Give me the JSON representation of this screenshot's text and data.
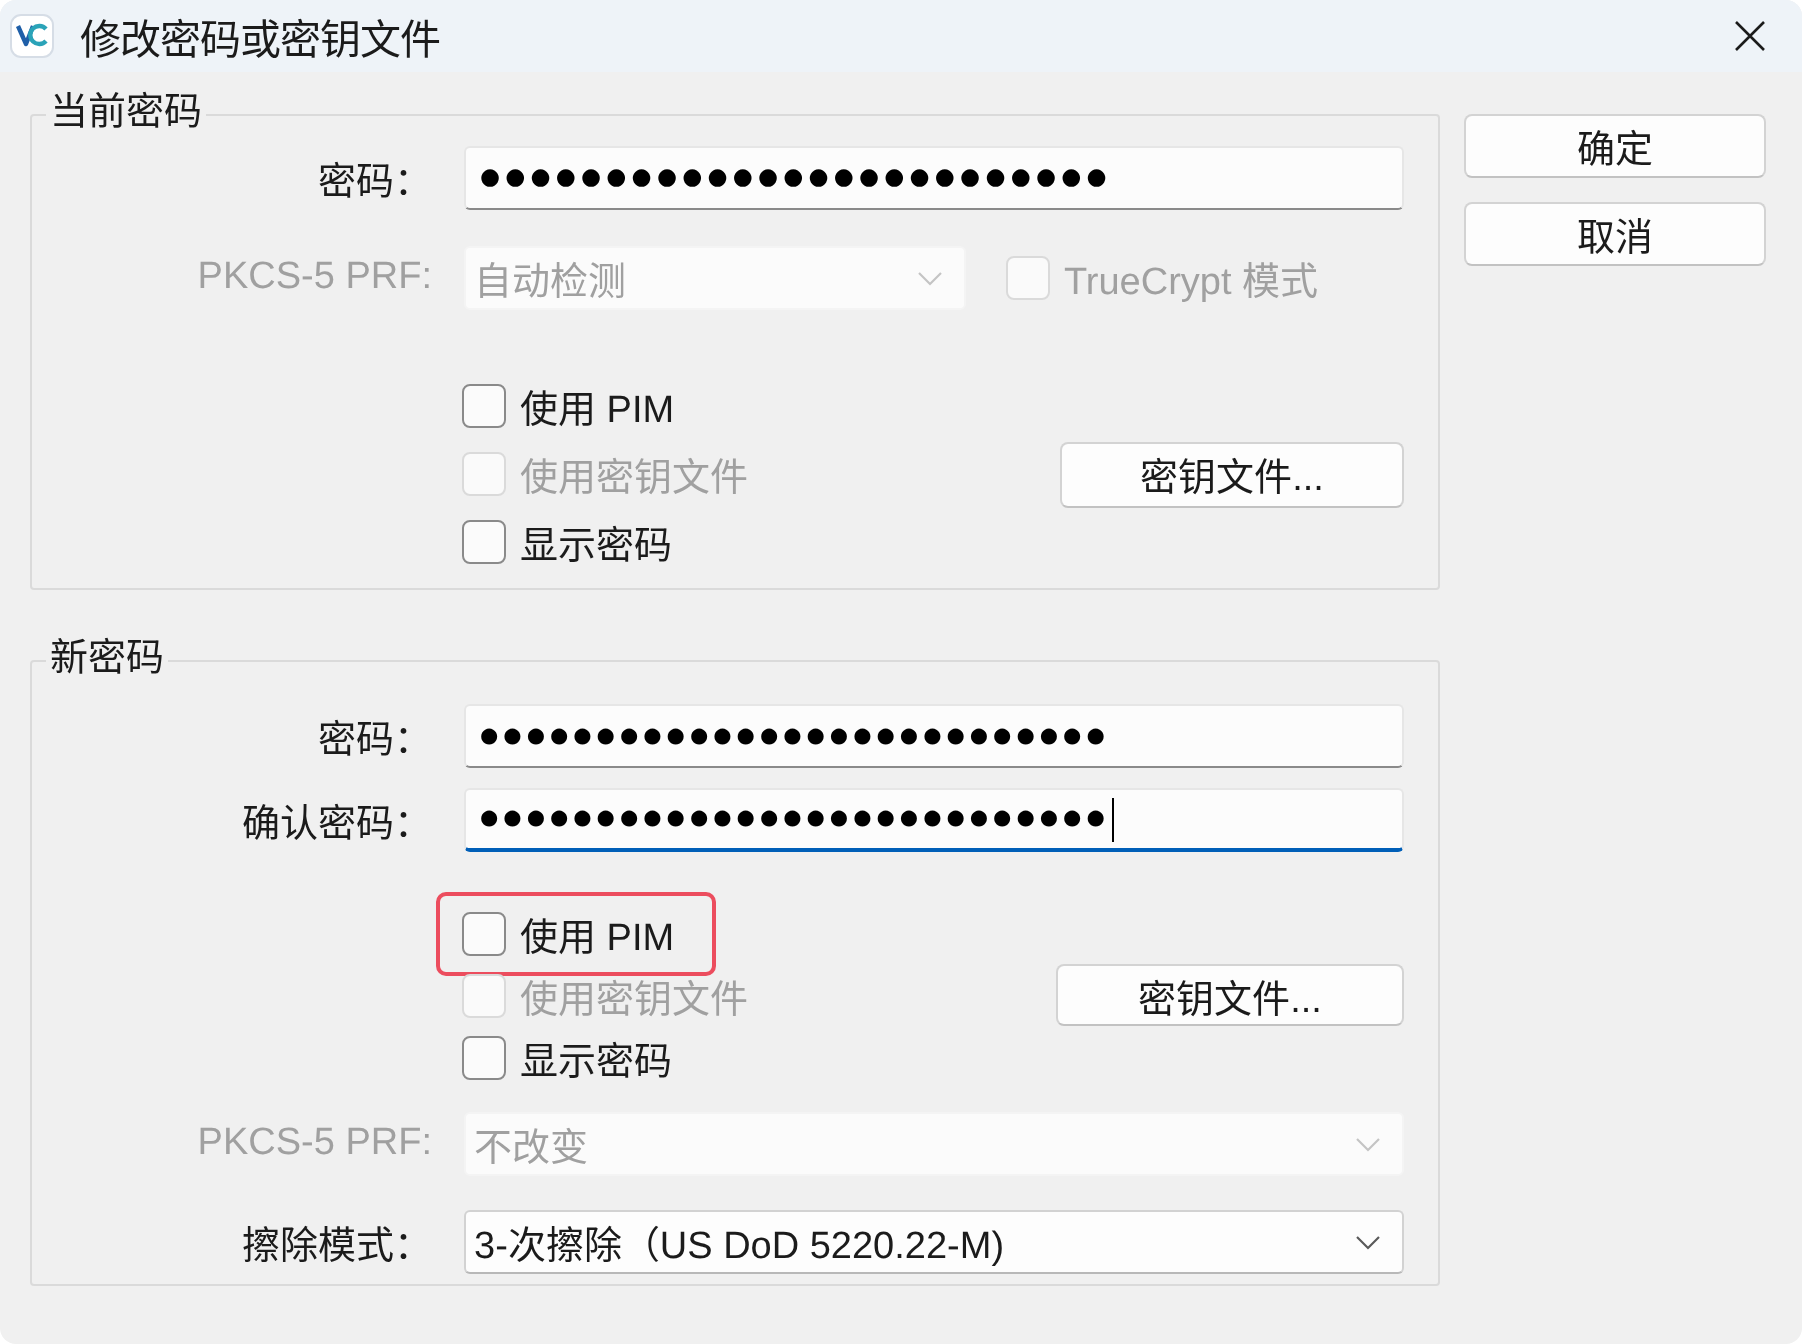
{
  "window": {
    "title": "修改密码或密钥文件"
  },
  "current": {
    "title": "当前密码",
    "password": {
      "label": "密码：",
      "value": "●●●●●●●●●●●●●●●●●●●●●●●●●",
      "focused": false
    },
    "prf": {
      "label": "PKCS-5 PRF:",
      "value": "自动检测",
      "disabled": true
    },
    "truecrypt_mode": {
      "label": "TrueCrypt 模式",
      "checked": false,
      "disabled": true
    },
    "options": [
      {
        "label": "使用 PIM",
        "checked": false,
        "disabled": false,
        "highlighted": false
      },
      {
        "label": "使用密钥文件",
        "checked": false,
        "disabled": true,
        "highlighted": false
      },
      {
        "label": "显示密码",
        "checked": false,
        "disabled": false,
        "highlighted": false
      }
    ],
    "keyfiles_button": {
      "label": "密钥文件...",
      "disabled": false
    }
  },
  "new": {
    "title": "新密码",
    "password": {
      "label": "密码：",
      "value": "●●●●●●●●●●●●●●●●●●●●●●●●●●●",
      "focused": false
    },
    "confirm": {
      "label": "确认密码：",
      "value": "●●●●●●●●●●●●●●●●●●●●●●●●●●●",
      "focused": true
    },
    "options": [
      {
        "label": "使用 PIM",
        "checked": false,
        "disabled": false,
        "highlighted": true
      },
      {
        "label": "使用密钥文件",
        "checked": false,
        "disabled": true,
        "highlighted": false
      },
      {
        "label": "显示密码",
        "checked": false,
        "disabled": false,
        "highlighted": false
      }
    ],
    "keyfiles_button": {
      "label": "密钥文件...",
      "disabled": false
    },
    "prf": {
      "label": "PKCS-5 PRF:",
      "value": "不改变",
      "disabled": true
    },
    "wipe_mode": {
      "label": "擦除模式：",
      "value": "3-次擦除（US DoD 5220.22-M)",
      "disabled": false
    }
  },
  "buttons": [
    {
      "label": "确定"
    },
    {
      "label": "取消"
    }
  ]
}
